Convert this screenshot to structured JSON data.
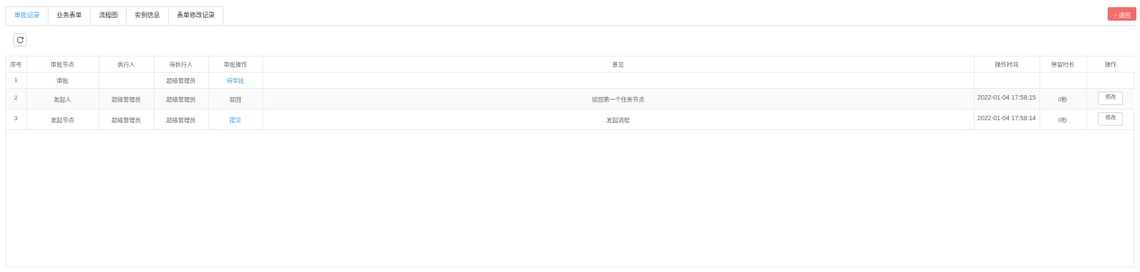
{
  "tabs": [
    {
      "label": "审批记录",
      "active": true
    },
    {
      "label": "业务表单",
      "active": false
    },
    {
      "label": "流程图",
      "active": false
    },
    {
      "label": "实例信息",
      "active": false
    },
    {
      "label": "表单修改记录",
      "active": false
    }
  ],
  "close_button": {
    "label": "○ 返回",
    "color": "#f56c6c"
  },
  "refresh_icon": "refresh-icon",
  "accent_color": "#409eff",
  "table": {
    "columns": [
      "序号",
      "审批节点",
      "执行人",
      "待执行人",
      "审批操作",
      "意见",
      "操作时间",
      "停留时长",
      "操作"
    ],
    "rows": [
      {
        "no": "1",
        "node": "审批",
        "executor": "",
        "pending": "超级管理员",
        "action": "待审批",
        "opinion": "",
        "time": "",
        "duration": "",
        "op": ""
      },
      {
        "no": "2",
        "node": "发起人",
        "executor": "超级管理员",
        "pending": "超级管理员",
        "action": "驳回",
        "opinion": "驳回第一个任务节点",
        "time": "2022-01-04 17:58:15",
        "duration": "0秒",
        "op": "修改"
      },
      {
        "no": "3",
        "node": "发起节点",
        "executor": "超级管理员",
        "pending": "超级管理员",
        "action": "提交",
        "opinion": "发起流程",
        "time": "2022-01-04 17:58:14",
        "duration": "0秒",
        "op": "修改"
      }
    ]
  }
}
